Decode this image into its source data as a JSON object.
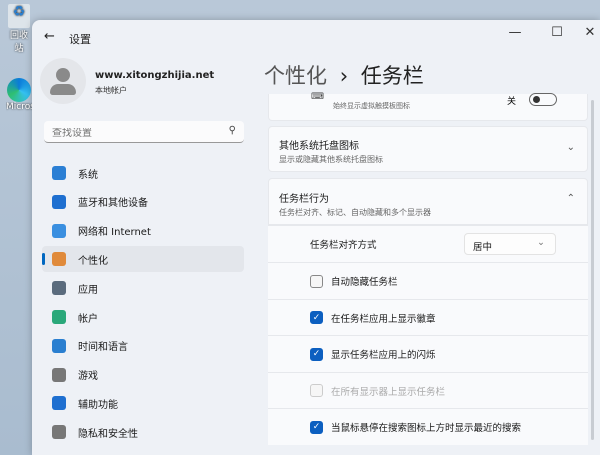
{
  "desktop": {
    "icons": [
      {
        "label": "回收站"
      },
      {
        "label": "Microsoft Edge"
      }
    ]
  },
  "window": {
    "title": "设置",
    "controls": [
      "minimize",
      "maximize",
      "close"
    ]
  },
  "user": {
    "name": "www.xitongzhijia.net",
    "account_type": "本地帐户"
  },
  "search": {
    "placeholder": "查找设置"
  },
  "sidebar": {
    "items": [
      {
        "label": "系统",
        "icon": "monitor-icon",
        "color": "#2b7fd4"
      },
      {
        "label": "蓝牙和其他设备",
        "icon": "bluetooth-icon",
        "color": "#1e6fd0"
      },
      {
        "label": "网络和 Internet",
        "icon": "wifi-icon",
        "color": "#3a8fe0"
      },
      {
        "label": "个性化",
        "icon": "brush-icon",
        "color": "#e08a3a",
        "selected": true
      },
      {
        "label": "应用",
        "icon": "apps-icon",
        "color": "#5a6b7d"
      },
      {
        "label": "帐户",
        "icon": "person-icon",
        "color": "#2aa87a"
      },
      {
        "label": "时间和语言",
        "icon": "globe-icon",
        "color": "#2a7fd0"
      },
      {
        "label": "游戏",
        "icon": "gamepad-icon",
        "color": "#777"
      },
      {
        "label": "辅助功能",
        "icon": "accessibility-icon",
        "color": "#1e6fd0"
      },
      {
        "label": "隐私和安全性",
        "icon": "shield-icon",
        "color": "#777"
      }
    ]
  },
  "header": {
    "parent": "个性化",
    "separator": "›",
    "current": "任务栏"
  },
  "cards": {
    "touchpad": {
      "subtitle": "始终显示虚拟触摸板图标",
      "state": "关"
    },
    "tray": {
      "title": "其他系统托盘图标",
      "subtitle": "显示或隐藏其他系统托盘图标"
    },
    "behavior": {
      "title": "任务栏行为",
      "subtitle": "任务栏对齐、标记、自动隐藏和多个显示器"
    }
  },
  "behavior": {
    "alignment": {
      "label": "任务栏对齐方式",
      "value": "居中"
    },
    "options": [
      {
        "label": "自动隐藏任务栏",
        "checked": false,
        "disabled": false
      },
      {
        "label": "在任务栏应用上显示徽章",
        "checked": true,
        "disabled": false
      },
      {
        "label": "显示任务栏应用上的闪烁",
        "checked": true,
        "disabled": false
      },
      {
        "label": "在所有显示器上显示任务栏",
        "checked": false,
        "disabled": true
      },
      {
        "label": "当鼠标悬停在搜索图标上方时显示最近的搜索",
        "checked": true,
        "disabled": false
      }
    ]
  }
}
